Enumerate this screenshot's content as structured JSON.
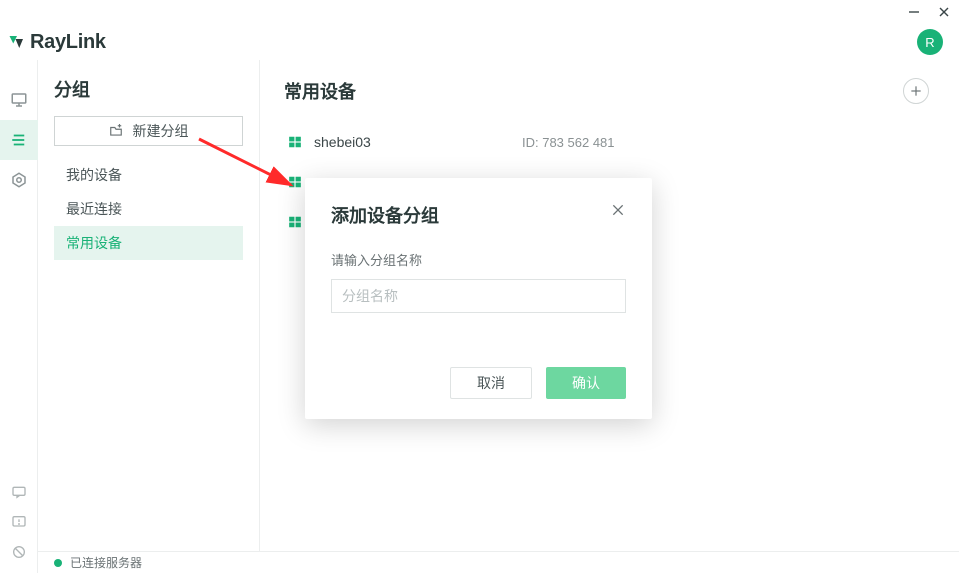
{
  "app": {
    "brand": "RayLink",
    "avatar_letter": "R"
  },
  "sidebar": {
    "title": "分组",
    "new_group_label": "新建分组",
    "items": [
      {
        "label": "我的设备"
      },
      {
        "label": "最近连接"
      },
      {
        "label": "常用设备"
      }
    ]
  },
  "content": {
    "title": "常用设备",
    "devices": [
      {
        "name": "shebei03",
        "id_label": "ID: 783 562 481"
      },
      {
        "name": "",
        "id_label": ""
      },
      {
        "name": "",
        "id_label": ""
      }
    ]
  },
  "modal": {
    "title": "添加设备分组",
    "label": "请输入分组名称",
    "placeholder": "分组名称",
    "cancel": "取消",
    "confirm": "确认"
  },
  "status": {
    "text": "已连接服务器"
  },
  "colors": {
    "accent": "#19b277",
    "confirm_bg": "#6dd7a0"
  }
}
